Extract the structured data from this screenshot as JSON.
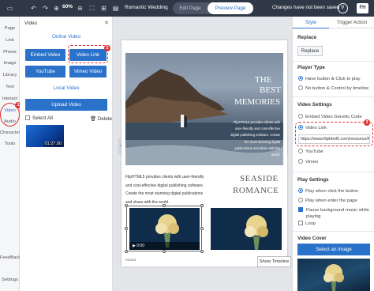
{
  "topbar": {
    "zoom": "60%",
    "title": "Romantic Wedding",
    "edit_label": "Edit Page",
    "preview_label": "Preview Page",
    "saved_text": "Changes have not been saved !",
    "help": "?",
    "logo": "FH"
  },
  "leftnav": {
    "items": [
      "Page",
      "Link",
      "Phone",
      "Image",
      "Library",
      "Text",
      "Interact",
      "Video",
      "Audio",
      "Character",
      "Tools",
      "FeedBack",
      "Settings"
    ]
  },
  "badges": {
    "one": "1",
    "two": "2",
    "three": "3"
  },
  "video_panel": {
    "title": "Video",
    "close": "✕",
    "online_label": "Online Video",
    "embed_label": "Embed Video",
    "videolink_label": "Video Link",
    "youtube_label": "YouTube",
    "vimeo_label": "Vimeo Video",
    "local_label": "Local Video",
    "upload_label": "Upload Video",
    "select_all": "Select All",
    "delete_label": "Delete",
    "video_duration": "01:27.00"
  },
  "canvas": {
    "hero_title_1": "THE",
    "hero_title_2": "BEST",
    "hero_title_3": "MEMORIES",
    "hero_body": "FlipHTML5 provides clients with user-friendly and cost-effective digital publishing software. Create the most stunning digital publications and share with the world.",
    "body_text": "FlipHTML5 provides clients with user-friendly and cost-effective digital publishing software. Create the most stunning digital publications and share with the world.",
    "seaside": "SEASIDE",
    "romance": "ROMANCE",
    "video_time": "0:00",
    "page_num": "PAGE5",
    "show_timeline": "Show Timeline"
  },
  "right_panel": {
    "tab_style": "Style",
    "tab_transition": "Trigger Action",
    "replace_heading": "Replace",
    "replace_btn": "Replace",
    "player_type_heading": "Player Type",
    "player_opt1": "Have button & Click to play",
    "player_opt2": "No button & Control by timeline",
    "video_settings_heading": "Video Settings",
    "vs_embed": "Embed Video Genetic Code",
    "vs_link": "Video Link",
    "link_value": "https://www.fliphtml5.com/resource/FI",
    "vs_youtube": "YouTube",
    "vs_vimeo": "Vimeo",
    "play_settings_heading": "Play Settings",
    "play_opt1": "Play when click the button",
    "play_opt2": "Play when enter the page",
    "pause_text": "Pause background music while playing",
    "loop_text": "Loop",
    "cover_heading": "Video Cover",
    "select_image": "Select an Image"
  }
}
